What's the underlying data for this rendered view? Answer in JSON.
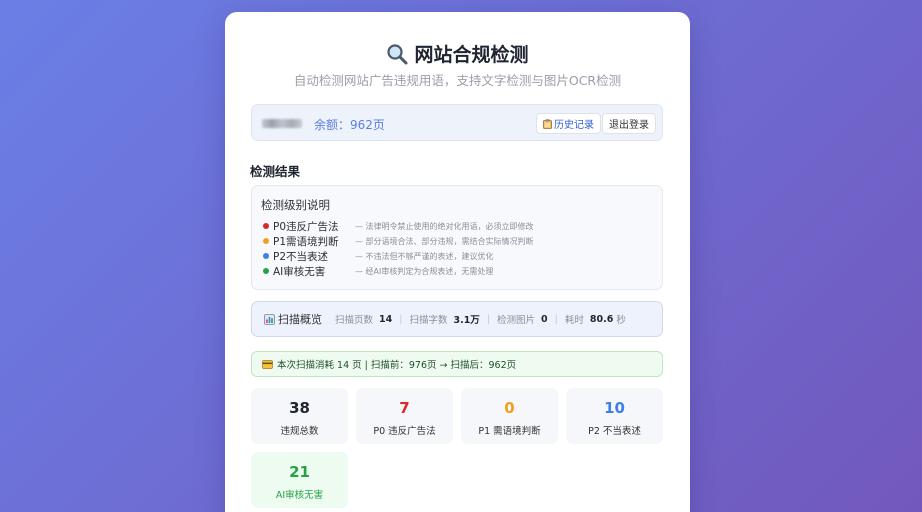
{
  "header": {
    "title": "网站合规检测",
    "subtitle": "自动检测网站广告违规用语，支持文字检测与图片OCR检测"
  },
  "user": {
    "balance": "余额：962页",
    "history_label": "历史记录",
    "logout_label": "退出登录"
  },
  "results": {
    "title": "检测结果",
    "legend": {
      "title": "检测级别说明",
      "items": [
        {
          "name": "P0违反广告法",
          "desc": "— 法律明令禁止使用的绝对化用语，必须立即修改",
          "color": "#d62b2b"
        },
        {
          "name": "P1需语境判断",
          "desc": "— 部分语境合法、部分违规，需结合实际情况判断",
          "color": "#f0a020"
        },
        {
          "name": "P2不当表述",
          "desc": "— 不违法但不够严谨的表述，建议优化",
          "color": "#3f7fe8"
        },
        {
          "name": "AI审核无害",
          "desc": "— 经AI审核判定为合规表述，无需处理",
          "color": "#23a344"
        }
      ]
    },
    "overview": {
      "label": "扫描概览",
      "pages_label": "扫描页数",
      "pages_value": "14",
      "chars_label": "扫描字数",
      "chars_value": "3.1万",
      "images_label": "检测图片",
      "images_value": "0",
      "time_label": "耗时",
      "time_value": "80.6",
      "time_unit": "秒"
    },
    "consumption": "本次扫描消耗 14 页 | 扫描前：976页 → 扫描后：962页",
    "stats": [
      {
        "value": "38",
        "label": "违规总数",
        "color": "#1f2530"
      },
      {
        "value": "7",
        "label": "P0 违反广告法",
        "color": "#d62b2b"
      },
      {
        "value": "0",
        "label": "P1 需语境判断",
        "color": "#f0a020"
      },
      {
        "value": "10",
        "label": "P2 不当表述",
        "color": "#3f7fe8"
      },
      {
        "value": "21",
        "label": "AI审核无害",
        "color": "#23a344"
      }
    ]
  },
  "icons": {
    "title": "magnifier-icon",
    "history": "clipboard-icon",
    "overview": "bar-chart-icon",
    "consumption": "card-icon"
  }
}
